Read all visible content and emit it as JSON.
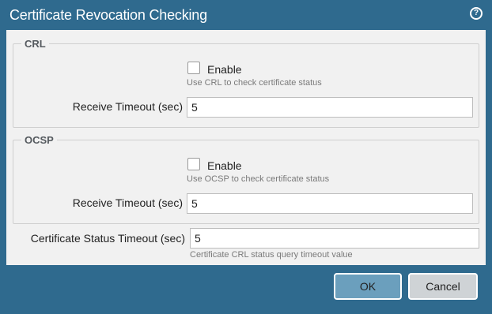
{
  "dialog": {
    "title": "Certificate Revocation Checking",
    "help_icon": "question-circle-icon"
  },
  "crl": {
    "legend": "CRL",
    "enable_label": "Enable",
    "enable_checked": false,
    "enable_help": "Use CRL to check certificate status",
    "timeout_label": "Receive Timeout (sec)",
    "timeout_value": "5"
  },
  "ocsp": {
    "legend": "OCSP",
    "enable_label": "Enable",
    "enable_checked": false,
    "enable_help": "Use OCSP to check certificate status",
    "timeout_label": "Receive Timeout (sec)",
    "timeout_value": "5"
  },
  "status_timeout": {
    "label": "Certificate Status Timeout (sec)",
    "value": "5",
    "help": "Certificate CRL status query timeout value"
  },
  "buttons": {
    "ok": "OK",
    "cancel": "Cancel"
  },
  "colors": {
    "frame": "#2f6a8e",
    "content_bg": "#f1f1f1",
    "ok_button": "#6b9fbd",
    "cancel_button": "#cfd3d6"
  }
}
